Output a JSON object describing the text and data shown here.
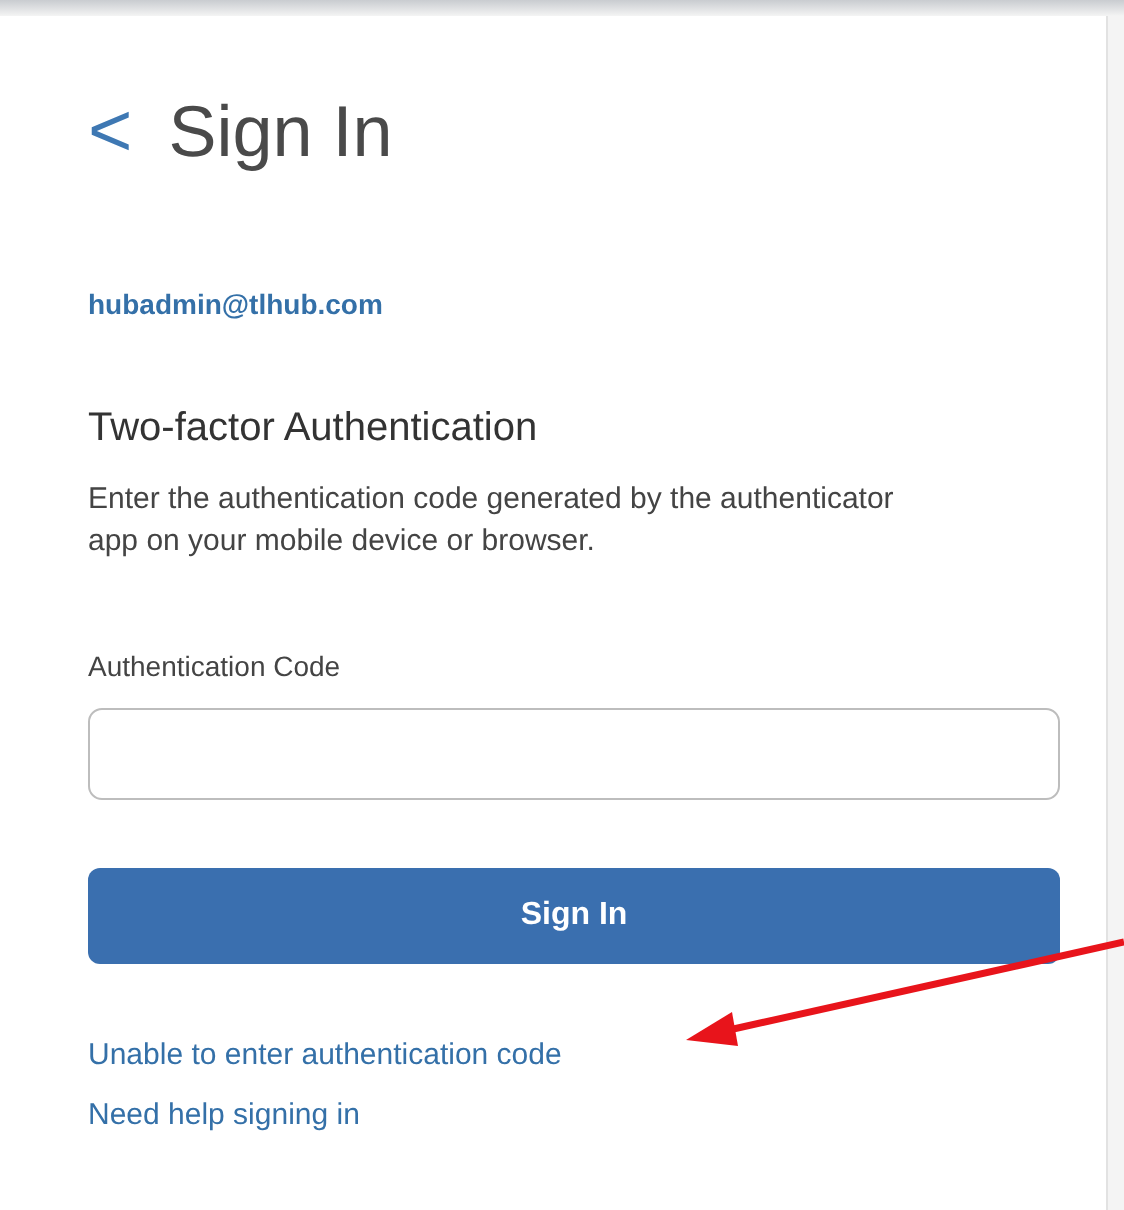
{
  "header": {
    "back_icon_text": "<",
    "title": "Sign In"
  },
  "account": {
    "email": "hubadmin@tlhub.com"
  },
  "section": {
    "title": "Two-factor Authentication",
    "description": "Enter the authentication code generated by the authenticator app on your mobile device or browser."
  },
  "field": {
    "label": "Authentication Code"
  },
  "buttons": [
    {
      "label": "Sign In"
    }
  ],
  "links": [
    {
      "label": "Unable to enter authentication code"
    },
    {
      "label": "Need help signing in"
    }
  ]
}
